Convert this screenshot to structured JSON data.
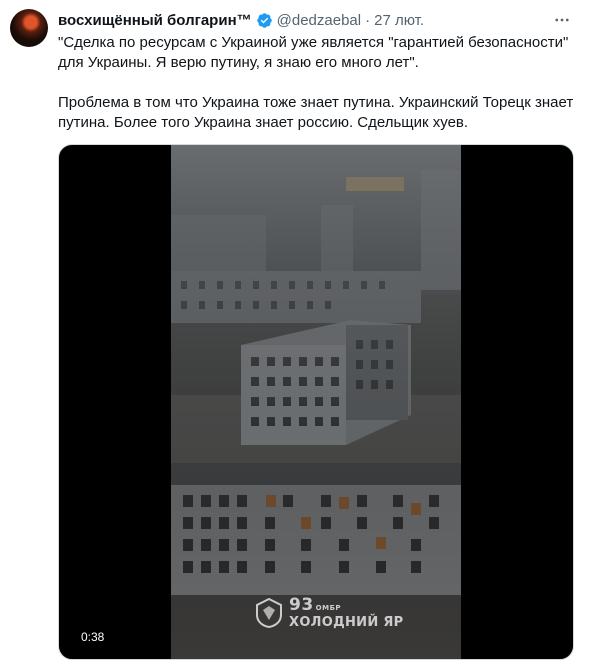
{
  "tweet": {
    "display_name": "восхищённый болгарин™",
    "handle": "@dedzaebal",
    "separator": "·",
    "time": "27 лют.",
    "paragraphs": [
      "\"Сделка по ресурсам с Украиной уже является \"гарантией безопасности\" для Украины. Я верю путину, я знаю его много лет\".",
      "Проблема в том что Украина тоже знает путина. Украинский Торецк знает путина. Более того Украина знает россию. Сдельщик хуев."
    ],
    "media": {
      "duration": "0:38",
      "watermark_number": "93",
      "watermark_unit": "ОМБР",
      "watermark_name": "ХОЛОДНИЙ ЯР"
    }
  },
  "icons": {
    "verified": "verified-badge-icon",
    "more": "more-options-icon"
  },
  "colors": {
    "verified_blue": "#1d9bf0",
    "secondary_text": "#536471"
  }
}
